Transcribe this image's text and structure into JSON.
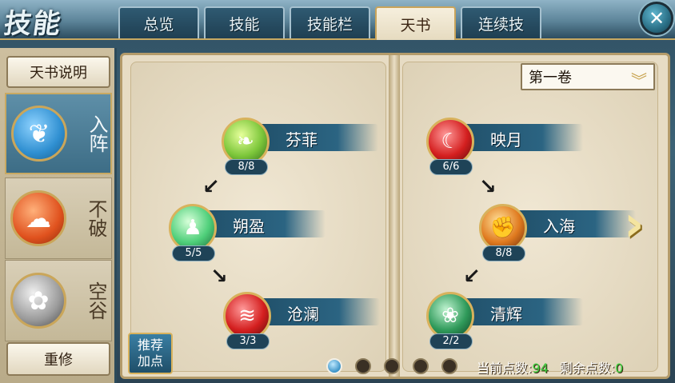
{
  "tabs": [
    {
      "label": "总览",
      "active": false
    },
    {
      "label": "技能",
      "active": false
    },
    {
      "label": "技能栏",
      "active": false
    },
    {
      "label": "天书",
      "active": true
    },
    {
      "label": "连续技",
      "active": false
    }
  ],
  "header": {
    "logo_text": "技能",
    "close_icon": "close-icon"
  },
  "left_panel": {
    "tianshu_button": "天书说明",
    "schools": [
      {
        "label": "入阵",
        "icon": "feather-icon",
        "active": true
      },
      {
        "label": "不破",
        "icon": "cloud-swirl-icon",
        "active": false
      },
      {
        "label": "空谷",
        "icon": "lotus-icon",
        "active": false
      }
    ],
    "rebuild_button": "重修"
  },
  "volume": {
    "selected": "第一卷",
    "chevron_icon": "chevron-down-icon"
  },
  "skills": {
    "fenfei": {
      "name": "芬菲",
      "count": "8/8",
      "icon": "vine-icon"
    },
    "shuoying": {
      "name": "朔盈",
      "count": "5/5",
      "icon": "figure-icon"
    },
    "canglan": {
      "name": "沧澜",
      "count": "3/3",
      "icon": "wave-icon"
    },
    "yingyue": {
      "name": "映月",
      "count": "6/6",
      "icon": "moon-icon"
    },
    "ruhai": {
      "name": "入海",
      "count": "8/8",
      "icon": "fist-icon"
    },
    "qinghui": {
      "name": "清辉",
      "count": "2/2",
      "icon": "dancer-icon"
    }
  },
  "recommend_button": {
    "line1": "推荐",
    "line2": "加点"
  },
  "pagination": {
    "total": 5,
    "current": 1
  },
  "points": {
    "current_label": "当前点数:",
    "current_value": "94",
    "remaining_label": "剩余点数:",
    "remaining_value": "0"
  }
}
